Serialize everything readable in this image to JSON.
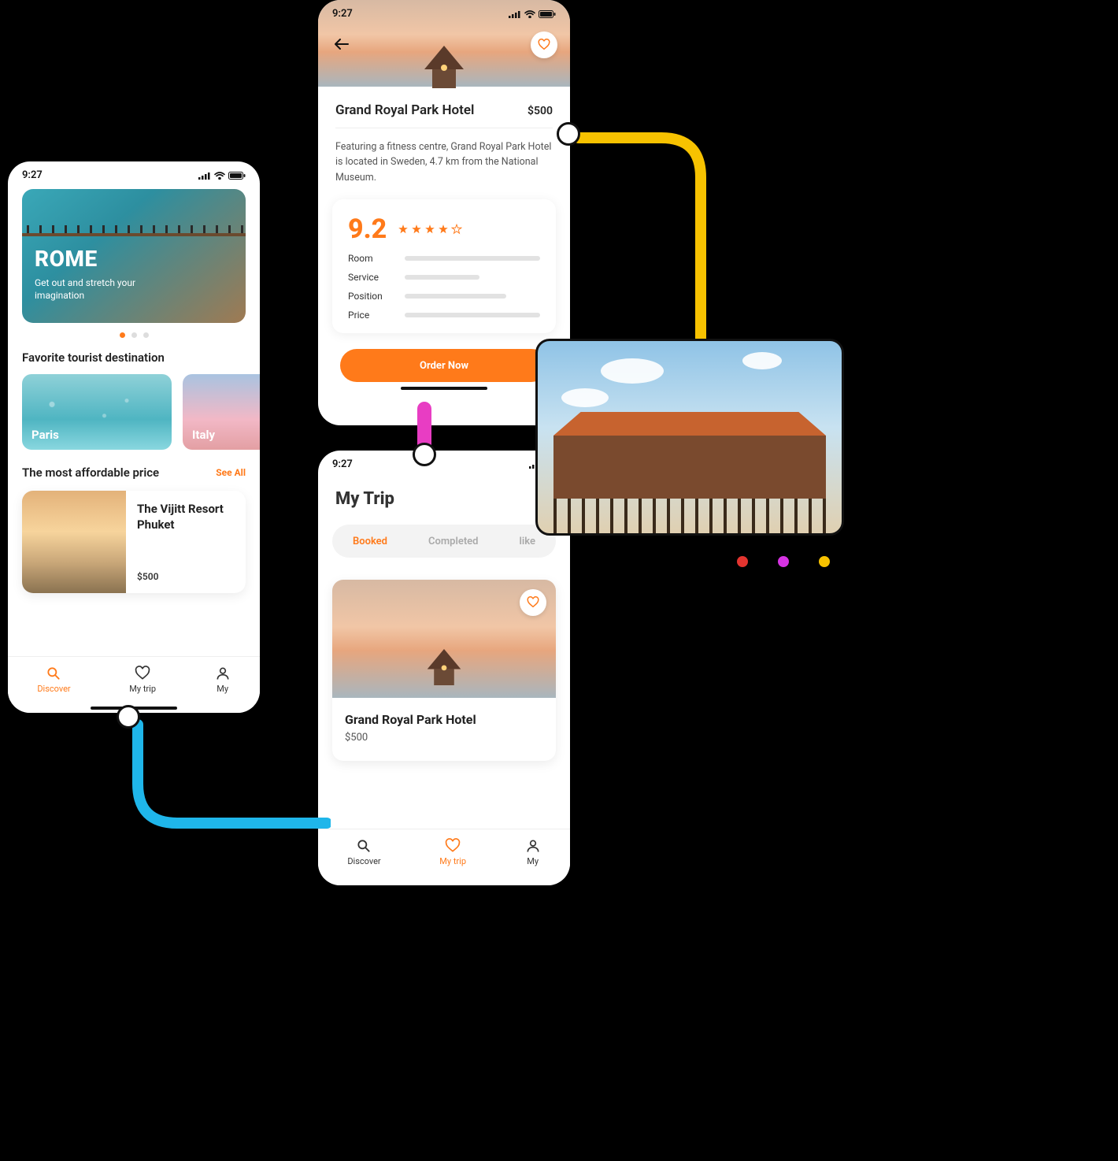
{
  "status_time": "9:27",
  "accent": "#ff7a1a",
  "discover": {
    "hero": {
      "title": "ROME",
      "subtitle": "Get out and stretch your imagination"
    },
    "carousel_index": 0,
    "favorite_title": "Favorite tourist destination",
    "destinations": [
      {
        "label": "Paris"
      },
      {
        "label": "Italy"
      }
    ],
    "affordable_title": "The most affordable price",
    "see_all_label": "See All",
    "affordable_card": {
      "title": "The Vijitt Resort Phuket",
      "price": "$500"
    },
    "tabs": [
      {
        "label": "Discover",
        "active": true
      },
      {
        "label": "My trip"
      },
      {
        "label": "My"
      }
    ]
  },
  "detail": {
    "title": "Grand Royal Park Hotel",
    "price": "$500",
    "description": "Featuring a fitness centre, Grand Royal Park Hotel is located in Sweden, 4.7 km from the National Museum.",
    "rating": "9.2",
    "stars_filled": 4,
    "stars_total": 5,
    "criteria": [
      {
        "label": "Room"
      },
      {
        "label": "Service"
      },
      {
        "label": "Position"
      },
      {
        "label": "Price"
      }
    ],
    "cta_label": "Order Now"
  },
  "trip": {
    "screen_title": "My Trip",
    "segments": [
      {
        "label": "Booked",
        "active": true
      },
      {
        "label": "Completed"
      },
      {
        "label": "like"
      }
    ],
    "card": {
      "title": "Grand Royal Park Hotel",
      "price": "$500"
    },
    "tabs": [
      {
        "label": "Discover"
      },
      {
        "label": "My trip",
        "active": true
      },
      {
        "label": "My"
      }
    ]
  }
}
